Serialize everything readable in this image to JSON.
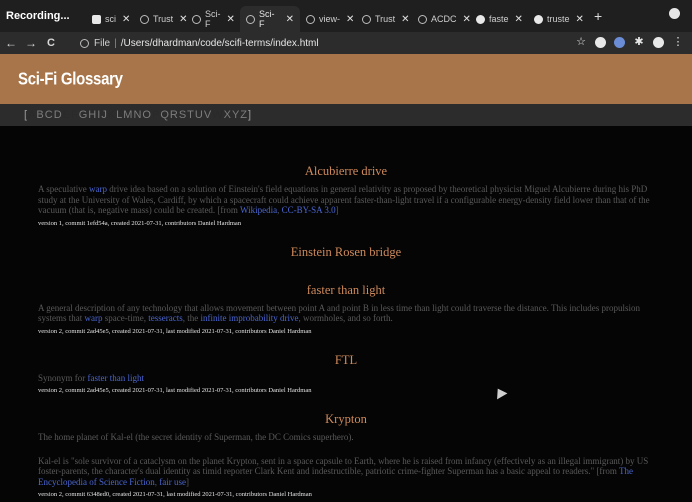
{
  "tabs": {
    "recording_label": "Recording...",
    "items": [
      {
        "label": "sci",
        "icon": "pause-icon"
      },
      {
        "label": "Trust",
        "icon": "globe-icon"
      },
      {
        "label": "Sci-F",
        "icon": "globe-icon"
      },
      {
        "label": "Sci-F",
        "icon": "globe-icon",
        "active": true
      },
      {
        "label": "view-",
        "icon": "globe-icon"
      },
      {
        "label": "Trust",
        "icon": "globe-icon"
      },
      {
        "label": "ACDC",
        "icon": "globe-icon"
      },
      {
        "label": "faste",
        "icon": "github-icon"
      },
      {
        "label": "truste",
        "icon": "github-icon"
      }
    ],
    "new_tab": "+"
  },
  "toolbar": {
    "back": "←",
    "forward": "→",
    "reload": "C",
    "file_label": "File",
    "separator": "|",
    "url": "/Users/dhardman/code/scifi-terms/index.html"
  },
  "page": {
    "title": "Sci-Fi Glossary",
    "alphabet": {
      "open": "[",
      "close": "]",
      "letters": [
        "A",
        "B",
        "C",
        "D",
        "E",
        "F",
        "G",
        "H",
        "I",
        "J",
        "K",
        "L",
        "M",
        "N",
        "O",
        "P",
        "Q",
        "R",
        "S",
        "T",
        "U",
        "V",
        "W",
        "X",
        "Y",
        "Z"
      ]
    },
    "entries": [
      {
        "term": "Alcubierre drive",
        "def_a": "A speculative ",
        "link1": "warp",
        "def_b": " drive idea based on a solution of Einstein's field equations in general relativity as proposed by theoretical physicist Miguel Alcubierre during his PhD study at the University of Wales, Cardiff, by which a spacecraft could achieve apparent faster-than-light travel if a configurable energy-density field lower than that of the vacuum (that is, negative mass) could be created. [from ",
        "link2": "Wikipedia",
        "def_c": ", ",
        "link3": "CC-BY-SA 3.0",
        "def_d": "]",
        "meta": "version 1, commit 1efd54a, created 2021-07-31, contributors Daniel Hardman"
      },
      {
        "term": "Einstein Rosen bridge"
      },
      {
        "term": "faster than light",
        "def_a": "A general description of any technology that allows movement between point A and point B in less time than light could traverse the distance. This includes propulsion systems that ",
        "link1": "warp",
        "def_b": " space-time, ",
        "link2": "tesseracts",
        "def_c": ", the ",
        "link3": "infinite improbability drive",
        "def_d": ", wormholes, and so forth.",
        "meta": "version 2, commit 2ad45e5, created 2021-07-31, last modified 2021-07-31, contributors Daniel Hardman"
      },
      {
        "term": "FTL",
        "def_a": "Synonym for ",
        "link1": "faster than light",
        "meta": "version 2, commit 2ad45e5, created 2021-07-31, last modified 2021-07-31, contributors Daniel Hardman"
      },
      {
        "term": "Krypton",
        "def_a": "The home planet of Kal-el (the secret identity of Superman, the DC Comics superhero).",
        "def_b": "Kal-el is \"sole survivor of a cataclysm on the planet Krypton, sent in a space capsule to Earth, where he is raised from infancy (effectively as an illegal immigrant) by US foster-parents, the character's dual identity as timid reporter Clark Kent and indestructible, patriotic crime-fighter Superman has a basic appeal to readers.\" [from ",
        "link1": "The Encyclopedia of Science Fiction",
        "def_c": ", ",
        "link2": "fair use",
        "def_d": "]",
        "meta": "version 2, commit 6348ed0, created 2021-07-31, last modified 2021-07-31, contributors Daniel Hardman"
      }
    ]
  }
}
